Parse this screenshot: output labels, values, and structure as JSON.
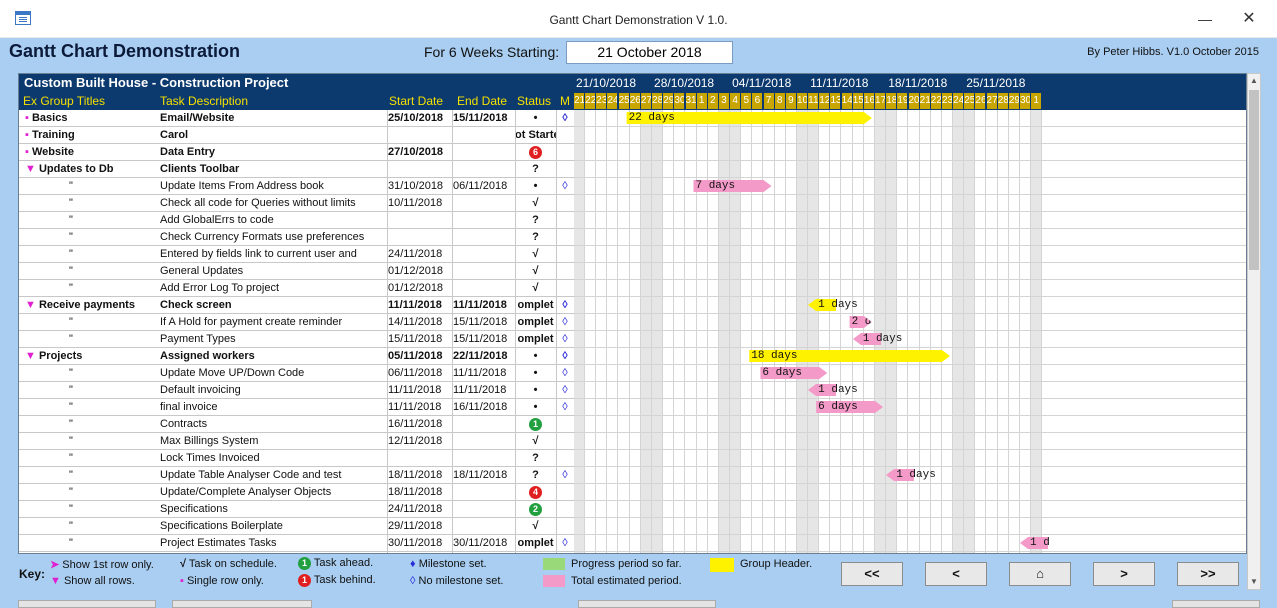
{
  "window": {
    "title": "Gantt Chart Demonstration  V 1.0.",
    "minimize": "—",
    "close": "✕"
  },
  "form": {
    "title": "Gantt Chart Demonstration",
    "weeks_label": "For 6 Weeks Starting:",
    "start_date": "21 October 2018",
    "byline": "By Peter Hibbs.  V1.0  October 2015"
  },
  "project": {
    "title": "Custom Built House - Construction Project",
    "columns": {
      "group": "Ex Group Titles",
      "task": "Task Description",
      "start": "Start Date",
      "end": "End Date",
      "status": "Status",
      "milestone": "M"
    }
  },
  "timeline": {
    "weeks": [
      "21/10/2018",
      "28/10/2018",
      "04/11/2018",
      "11/11/2018",
      "18/11/2018",
      "25/11/2018"
    ],
    "days": [
      "21",
      "22",
      "23",
      "24",
      "25",
      "26",
      "27",
      "28",
      "29",
      "30",
      "31",
      "1",
      "2",
      "3",
      "4",
      "5",
      "6",
      "7",
      "8",
      "9",
      "10",
      "11",
      "12",
      "13",
      "14",
      "15",
      "16",
      "17",
      "18",
      "19",
      "20",
      "21",
      "22",
      "23",
      "24",
      "25",
      "26",
      "27",
      "28",
      "29",
      "30",
      "1"
    ]
  },
  "rows": [
    {
      "bullet": "▪",
      "group": "Basics",
      "task": "Email/Website",
      "start": "25/10/2018",
      "end": "15/11/2018",
      "status": "•",
      "m": "◊",
      "grp": true
    },
    {
      "bullet": "▪",
      "group": "Training",
      "task": "Carol",
      "start": "",
      "end": "",
      "status": "ot Starte",
      "m": "",
      "grp": true
    },
    {
      "bullet": "▪",
      "group": "Website",
      "task": "Data Entry",
      "start": "27/10/2018",
      "end": "",
      "status": "6",
      "m": "",
      "grp": true,
      "badge": "red"
    },
    {
      "bullet": "▼",
      "group": "Updates to Db",
      "task": "Clients Toolbar",
      "start": "",
      "end": "",
      "status": "?",
      "m": "",
      "grp": true
    },
    {
      "bullet": "",
      "group": "\"",
      "task": "Update Items From Address book",
      "start": "31/10/2018",
      "end": "06/11/2018",
      "status": "•",
      "m": "◊"
    },
    {
      "bullet": "",
      "group": "\"",
      "task": "Check all code for Queries without limits",
      "start": "10/11/2018",
      "end": "",
      "status": "√",
      "m": ""
    },
    {
      "bullet": "",
      "group": "\"",
      "task": "Add GlobalErrs to code",
      "start": "",
      "end": "",
      "status": "?",
      "m": ""
    },
    {
      "bullet": "",
      "group": "\"",
      "task": "Check Currency Formats use preferences",
      "start": "",
      "end": "",
      "status": "?",
      "m": ""
    },
    {
      "bullet": "",
      "group": "\"",
      "task": "Entered by fields link to current user and",
      "start": "24/11/2018",
      "end": "",
      "status": "√",
      "m": ""
    },
    {
      "bullet": "",
      "group": "\"",
      "task": "General Updates",
      "start": "01/12/2018",
      "end": "",
      "status": "√",
      "m": ""
    },
    {
      "bullet": "",
      "group": "\"",
      "task": "Add Error Log To project",
      "start": "01/12/2018",
      "end": "",
      "status": "√",
      "m": ""
    },
    {
      "bullet": "▼",
      "group": "Receive payments",
      "task": "Check screen",
      "start": "11/11/2018",
      "end": "11/11/2018",
      "status": "omplet",
      "m": "◊",
      "grp": true
    },
    {
      "bullet": "",
      "group": "\"",
      "task": "If A Hold for payment create reminder",
      "start": "14/11/2018",
      "end": "15/11/2018",
      "status": "omplet",
      "m": "◊"
    },
    {
      "bullet": "",
      "group": "\"",
      "task": "Payment Types",
      "start": "15/11/2018",
      "end": "15/11/2018",
      "status": "omplet",
      "m": "◊"
    },
    {
      "bullet": "▼",
      "group": "Projects",
      "task": "Assigned workers",
      "start": "05/11/2018",
      "end": "22/11/2018",
      "status": "•",
      "m": "◊",
      "grp": true
    },
    {
      "bullet": "",
      "group": "\"",
      "task": "Update Move UP/Down Code",
      "start": "06/11/2018",
      "end": "11/11/2018",
      "status": "•",
      "m": "◊"
    },
    {
      "bullet": "",
      "group": "\"",
      "task": "Default invoicing",
      "start": "11/11/2018",
      "end": "11/11/2018",
      "status": "•",
      "m": "◊"
    },
    {
      "bullet": "",
      "group": "\"",
      "task": "final invoice",
      "start": "11/11/2018",
      "end": "16/11/2018",
      "status": "•",
      "m": "◊"
    },
    {
      "bullet": "",
      "group": "\"",
      "task": "Contracts",
      "start": "16/11/2018",
      "end": "",
      "status": "1",
      "m": "",
      "badge": "green"
    },
    {
      "bullet": "",
      "group": "\"",
      "task": "Max Billings System",
      "start": "12/11/2018",
      "end": "",
      "status": "√",
      "m": ""
    },
    {
      "bullet": "",
      "group": "\"",
      "task": "Lock Times Invoiced",
      "start": "",
      "end": "",
      "status": "?",
      "m": ""
    },
    {
      "bullet": "",
      "group": "\"",
      "task": "Update Table Analyser Code and test",
      "start": "18/11/2018",
      "end": "18/11/2018",
      "status": "?",
      "m": "◊"
    },
    {
      "bullet": "",
      "group": "\"",
      "task": "Update/Complete Analyser Objects",
      "start": "18/11/2018",
      "end": "",
      "status": "4",
      "m": "",
      "badge": "red"
    },
    {
      "bullet": "",
      "group": "\"",
      "task": "Specifications",
      "start": "24/11/2018",
      "end": "",
      "status": "2",
      "m": "",
      "badge": "green"
    },
    {
      "bullet": "",
      "group": "\"",
      "task": "Specifications Boilerplate",
      "start": "29/11/2018",
      "end": "",
      "status": "√",
      "m": ""
    },
    {
      "bullet": "",
      "group": "\"",
      "task": "Project Estimates Tasks",
      "start": "30/11/2018",
      "end": "30/11/2018",
      "status": "omplet",
      "m": "◊"
    }
  ],
  "bars": [
    {
      "row": 0,
      "startDay": 4,
      "days": 22,
      "label": "22 days",
      "kind": "ylw"
    },
    {
      "row": 4,
      "startDay": 10,
      "days": 7,
      "label": "7 days",
      "kind": "pnk"
    },
    {
      "row": 11,
      "startDay": 21,
      "days": 1,
      "label": "1 days",
      "kind": "ylw"
    },
    {
      "row": 12,
      "startDay": 24,
      "days": 2,
      "label": "2 days",
      "kind": "pnk"
    },
    {
      "row": 13,
      "startDay": 25,
      "days": 1,
      "label": "1 days",
      "kind": "pnk"
    },
    {
      "row": 14,
      "startDay": 15,
      "days": 18,
      "label": "18 days",
      "kind": "ylw"
    },
    {
      "row": 15,
      "startDay": 16,
      "days": 6,
      "label": "6 days",
      "kind": "pnk"
    },
    {
      "row": 16,
      "startDay": 21,
      "days": 1,
      "label": "1 days",
      "kind": "pnk"
    },
    {
      "row": 17,
      "startDay": 21,
      "days": 6,
      "label": "6 days",
      "kind": "pnk"
    },
    {
      "row": 21,
      "startDay": 28,
      "days": 1,
      "label": "1 days",
      "kind": "pnk"
    },
    {
      "row": 25,
      "startDay": 40,
      "days": 1,
      "label": "1 d",
      "kind": "pnk"
    }
  ],
  "legend": {
    "key": "Key:",
    "show_first": "Show 1st row only.",
    "show_all": "Show all rows.",
    "on_schedule": "Task on schedule.",
    "single_row": "Single row only.",
    "ahead": "Task ahead.",
    "behind": "Task behind.",
    "milestone_set": "Milestone set.",
    "no_milestone": "No milestone set.",
    "progress": "Progress period so far.",
    "total": "Total estimated period.",
    "group_header": "Group Header.",
    "ahead_badge": "1",
    "behind_badge": "1"
  },
  "nav": {
    "first": "<<",
    "prev": "<",
    "home": "⌂",
    "next": ">",
    "last": ">>"
  },
  "colors": {
    "header_bg": "#0c3a6e",
    "form_bg": "#a9cef2",
    "yellow": "#fff200",
    "pink": "#f49ac8",
    "gold_days": "#c9a500"
  }
}
